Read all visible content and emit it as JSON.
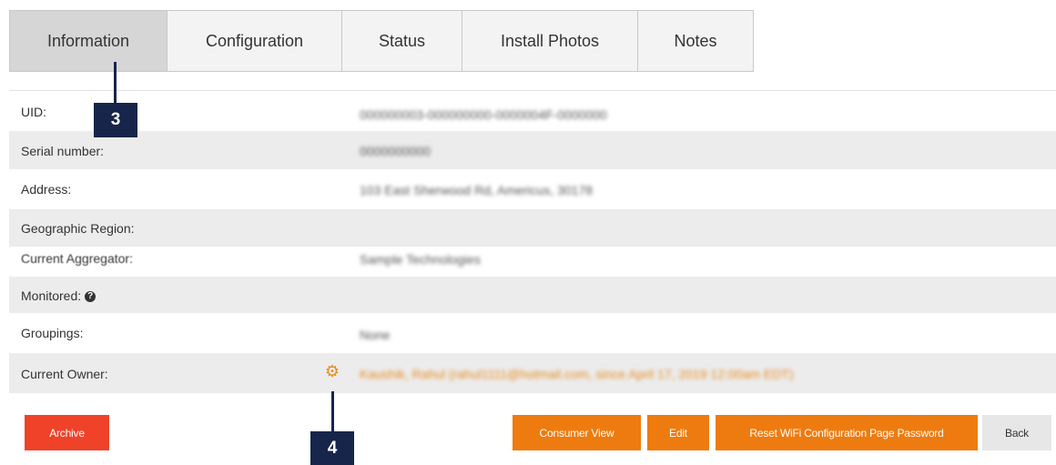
{
  "tabs": [
    {
      "label": "Information",
      "active": true
    },
    {
      "label": "Configuration",
      "active": false
    },
    {
      "label": "Status",
      "active": false
    },
    {
      "label": "Install Photos",
      "active": false
    },
    {
      "label": "Notes",
      "active": false
    }
  ],
  "rows": [
    {
      "label": "UID:",
      "value": "000000003-000000000-0000004F-0000000"
    },
    {
      "label": "Serial number:",
      "value": "0000000000"
    },
    {
      "label": "Address:",
      "value": "103 East Sherwood Rd, Americus, 30178"
    },
    {
      "label": "Geographic Region:",
      "value": ""
    },
    {
      "label": "Current Aggregator:",
      "value": "Sample Technologies"
    },
    {
      "label": "Monitored:",
      "value": ""
    },
    {
      "label": "Groupings:",
      "value": "None"
    },
    {
      "label": "Current Owner:",
      "value": "Kaushik, Rahul (rahul1111@hotmail.com, since April 17, 2019 12:00am EDT)"
    }
  ],
  "buttons": {
    "archive": "Archive",
    "consumer_view": "Consumer View",
    "edit": "Edit",
    "reset_wifi": "Reset WiFi Configuration Page Password",
    "back": "Back"
  },
  "callouts": {
    "c3": "3",
    "c4": "4"
  },
  "icons": {
    "monitored_help": "question-circle-icon",
    "owner_settings": "gear-icon"
  },
  "colors": {
    "accent": "#ee7b0f",
    "danger": "#ef4229",
    "callout": "#17254a",
    "active_tab": "#d6d6d6"
  }
}
